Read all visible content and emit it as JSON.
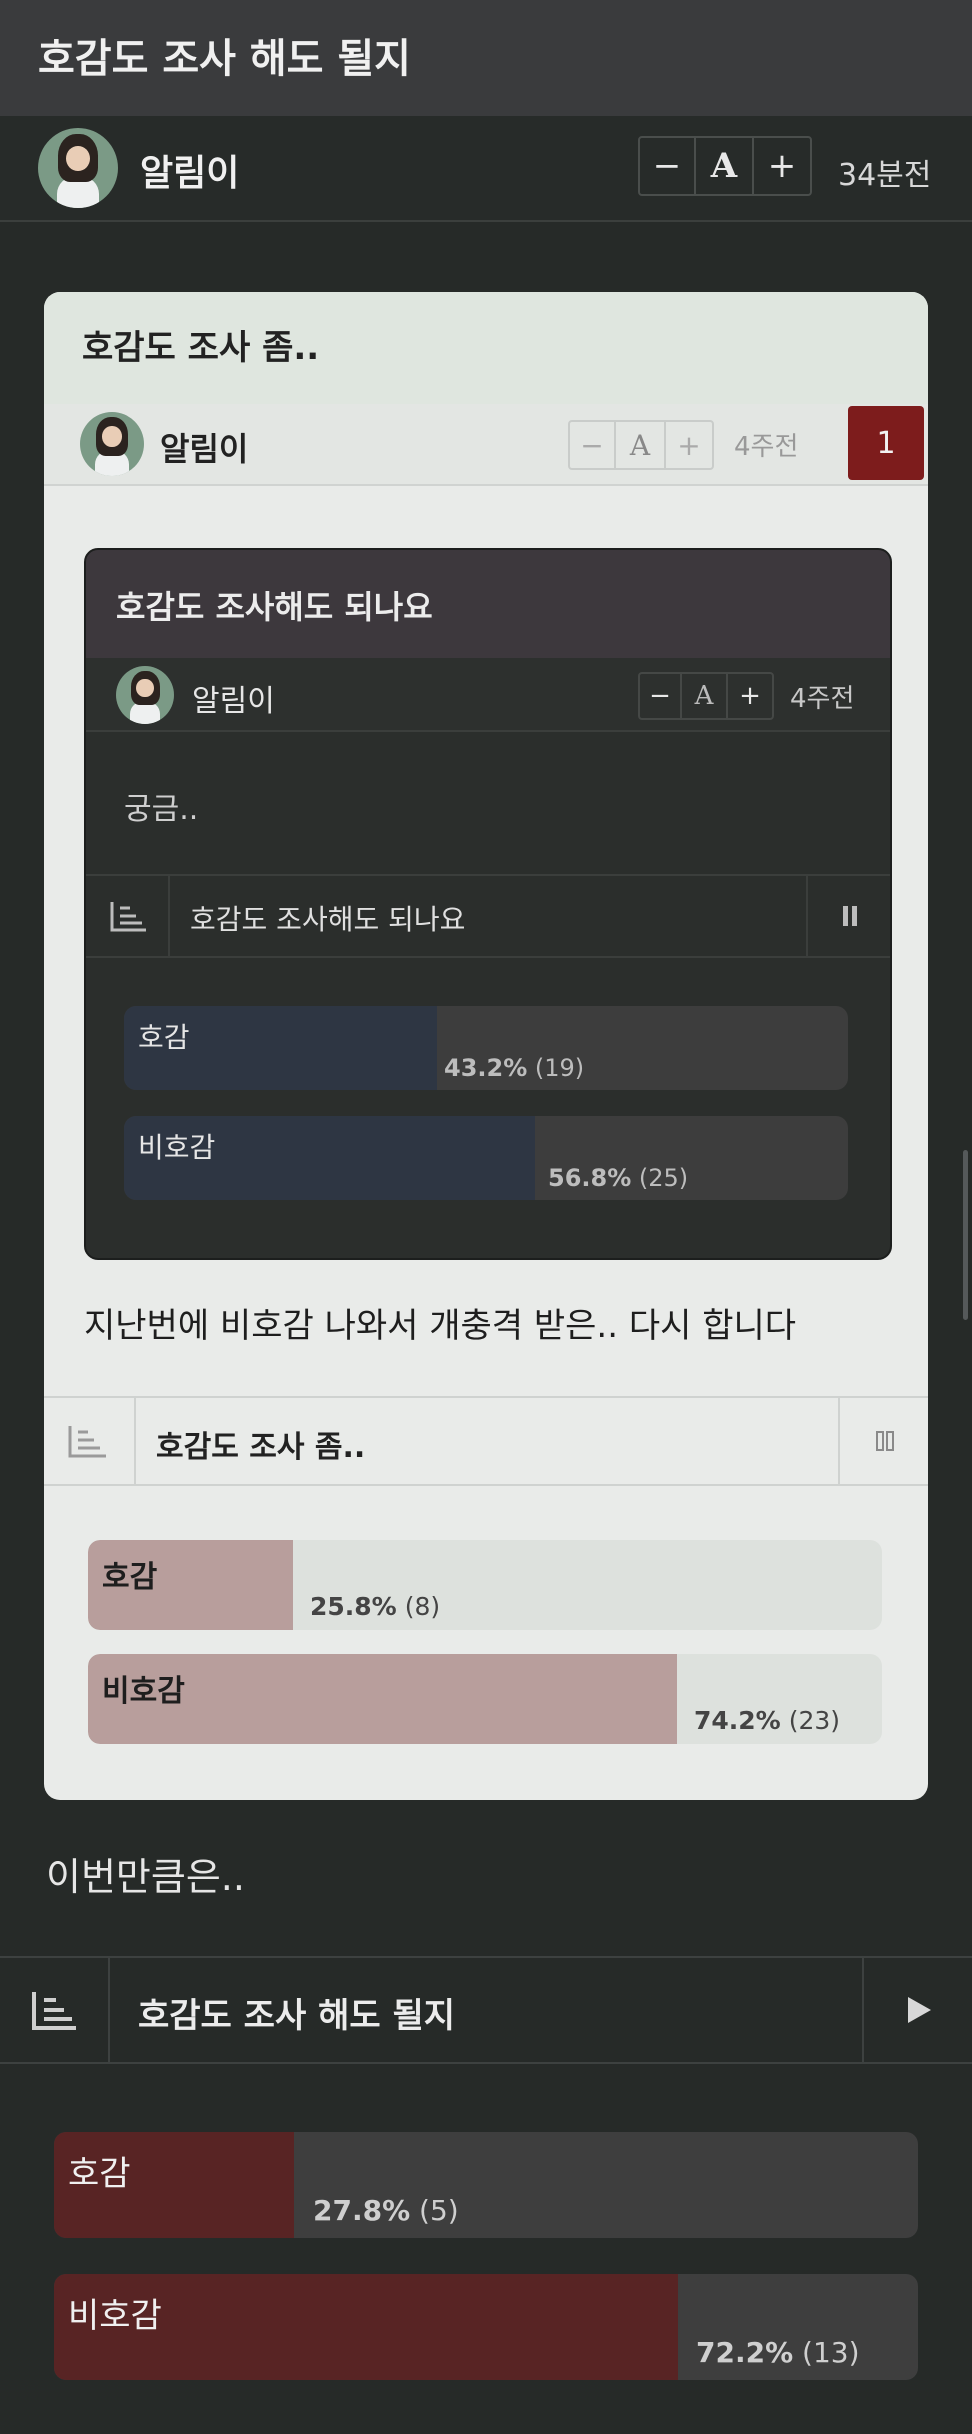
{
  "page": {
    "title": "호감도 조사 해도 될지",
    "author": "알림이",
    "font_ctl": {
      "minus": "−",
      "a": "A",
      "plus": "+"
    },
    "time": "34분전"
  },
  "card": {
    "title": "호감도 조사 좀..",
    "author": "알림이",
    "time": "4주전",
    "badge": "1",
    "inner": {
      "title": "호감도 조사해도 되나요",
      "author": "알림이",
      "time": "4주전",
      "body": "궁금..",
      "poll": {
        "title": "호감도 조사해도 되나요",
        "options": [
          {
            "label": "호감",
            "pct": "43.2%",
            "count": "(19)",
            "value": 43.2
          },
          {
            "label": "비호감",
            "pct": "56.8%",
            "count": "(25)",
            "value": 56.8
          }
        ]
      }
    },
    "body": "지난번에 비호감 나와서 개충격 받은.. 다시 합니다",
    "poll": {
      "title": "호감도 조사 좀..",
      "options": [
        {
          "label": "호감",
          "pct": "25.8%",
          "count": "(8)",
          "value": 25.8
        },
        {
          "label": "비호감",
          "pct": "74.2%",
          "count": "(23)",
          "value": 74.2
        }
      ]
    }
  },
  "body": "이번만큼은..",
  "poll": {
    "title": "호감도 조사 해도 될지",
    "options": [
      {
        "label": "호감",
        "pct": "27.8%",
        "count": "(5)",
        "value": 27.8
      },
      {
        "label": "비호감",
        "pct": "72.2%",
        "count": "(13)",
        "value": 72.2
      }
    ]
  },
  "colors": {
    "main_bar": "#582424",
    "card_bar": "#b89e9c",
    "inner_bar": "#2e3643"
  }
}
